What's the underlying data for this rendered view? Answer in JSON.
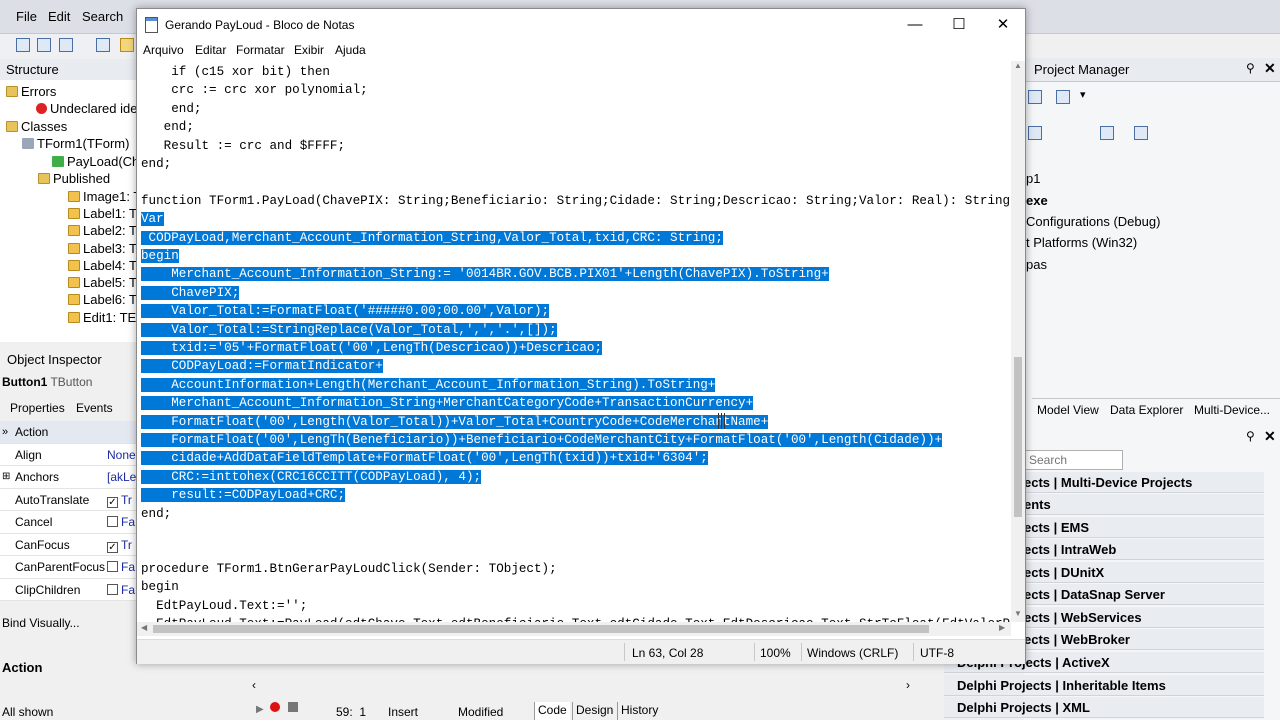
{
  "ide": {
    "menu": [
      "File",
      "Edit",
      "Search"
    ],
    "structure": {
      "title": "Structure",
      "rows": [
        "Errors",
        "Undeclared ide",
        "Classes",
        "TForm1(TForm)",
        "PayLoad(Ch",
        "Published",
        "Image1: T",
        "Label1: T",
        "Label2: T",
        "Label3: T",
        "Label4: T",
        "Label5: T",
        "Label6: T",
        "Edit1: TE"
      ]
    },
    "object_inspector": {
      "title": "Object Inspector",
      "component": "Button1",
      "component_type": "TButton",
      "tabs": [
        "Properties",
        "Events"
      ],
      "rows": [
        {
          "key": "Action",
          "value": ""
        },
        {
          "key": "Align",
          "value": "None"
        },
        {
          "key": "Anchors",
          "value": "[akLe"
        },
        {
          "key": "AutoTranslate",
          "value": "Tr"
        },
        {
          "key": "Cancel",
          "value": "Fa"
        },
        {
          "key": "CanFocus",
          "value": "Tr"
        },
        {
          "key": "CanParentFocus",
          "value": "Fa"
        },
        {
          "key": "ClipChildren",
          "value": "Fa"
        }
      ],
      "bind_visually": "Bind Visually...",
      "action_label": "Action",
      "all_shown": "All shown"
    },
    "project_manager": {
      "title": "Project Manager",
      "items": [
        "p1",
        "exe",
        "Configurations (Debug)",
        "t Platforms (Win32)",
        "pas"
      ],
      "tabs": [
        "Model View",
        "Data Explorer",
        "Multi-Device..."
      ],
      "search_placeholder": "Search"
    },
    "tool_palette": [
      "ects | Multi-Device Projects",
      "ents",
      "ects | EMS",
      "ects | IntraWeb",
      "ects | DUnitX",
      "ects | DataSnap Server",
      "ects | WebServices",
      "ects | WebBroker",
      "Delphi Projects | ActiveX",
      "Delphi Projects | Inheritable Items",
      "Delphi Projects | XML"
    ],
    "editor_status": {
      "position": "59:  1",
      "mode": "Insert",
      "state": "Modified"
    },
    "editor_tabs": [
      "Code",
      "Design",
      "History"
    ]
  },
  "notepad": {
    "title": "Gerando PayLoud - Bloco de Notas",
    "menu": [
      "Arquivo",
      "Editar",
      "Formatar",
      "Exibir",
      "Ajuda"
    ],
    "lines": [
      {
        "text": "    if (c15 xor bit) then",
        "selected": false
      },
      {
        "text": "    crc := crc xor polynomial;",
        "selected": false
      },
      {
        "text": "    end;",
        "selected": false
      },
      {
        "text": "   end;",
        "selected": false
      },
      {
        "text": "   Result := crc and $FFFF;",
        "selected": false
      },
      {
        "text": "end;",
        "selected": false
      },
      {
        "text": "",
        "selected": false
      },
      {
        "text": "function TForm1.PayLoad(ChavePIX: String;Beneficiario: String;Cidade: String;Descricao: String;Valor: Real): String;",
        "selected": false
      },
      {
        "text": "Var",
        "selected": true
      },
      {
        "text": " CODPayLoad,Merchant_Account_Information_String,Valor_Total,txid,CRC: String;",
        "selected": true
      },
      {
        "text": "begin",
        "selected": true
      },
      {
        "text": "    Merchant_Account_Information_String:= '0014BR.GOV.BCB.PIX01'+Length(ChavePIX).ToString+",
        "selected": true
      },
      {
        "text": "    ChavePIX;",
        "selected": true
      },
      {
        "text": "    Valor_Total:=FormatFloat('#####0.00;00.00',Valor);",
        "selected": true
      },
      {
        "text": "    Valor_Total:=StringReplace(Valor_Total,',','.',[]);",
        "selected": true
      },
      {
        "text": "    txid:='05'+FormatFloat('00',LengTh(Descricao))+Descricao;",
        "selected": true
      },
      {
        "text": "    CODPayLoad:=FormatIndicator+",
        "selected": true
      },
      {
        "text": "    AccountInformation+Length(Merchant_Account_Information_String).ToString+",
        "selected": true
      },
      {
        "text": "    Merchant_Account_Information_String+MerchantCategoryCode+TransactionCurrency+",
        "selected": true
      },
      {
        "text": "    FormatFloat('00',Length(Valor_Total))+Valor_Total+CountryCode+CodeMerchantName+",
        "selected": true
      },
      {
        "text": "    FormatFloat('00',LengTh(Beneficiario))+Beneficiario+CodeMerchantCity+FormatFloat('00',Length(Cidade))+",
        "selected": true
      },
      {
        "text": "    cidade+AddDataFieldTemplate+FormatFloat('00',LengTh(txid))+txid+'6304';",
        "selected": true
      },
      {
        "text": "    CRC:=inttohex(CRC16CCITT(CODPayLoad), 4);",
        "selected": true
      },
      {
        "text": "    result:=CODPayLoad+CRC;",
        "selected": true
      },
      {
        "text": "end;",
        "selected": false
      },
      {
        "text": "",
        "selected": false
      },
      {
        "text": "",
        "selected": false
      },
      {
        "text": "procedure TForm1.BtnGerarPayLoudClick(Sender: TObject);",
        "selected": false
      },
      {
        "text": "begin",
        "selected": false
      },
      {
        "text": "  EdtPayLoud.Text:='';",
        "selected": false
      },
      {
        "text": "  EdtPayLoud.Text:=PayLoad(edtChave.Text,edtBeneficiario.Text,edtCidade.Text,EdtDescricao.Text,StrToFloat(EdtValorP",
        "selected": false
      }
    ],
    "status": {
      "position": "Ln 63, Col 28",
      "zoom": "100%",
      "line_ending": "Windows (CRLF)",
      "encoding": "UTF-8"
    }
  }
}
